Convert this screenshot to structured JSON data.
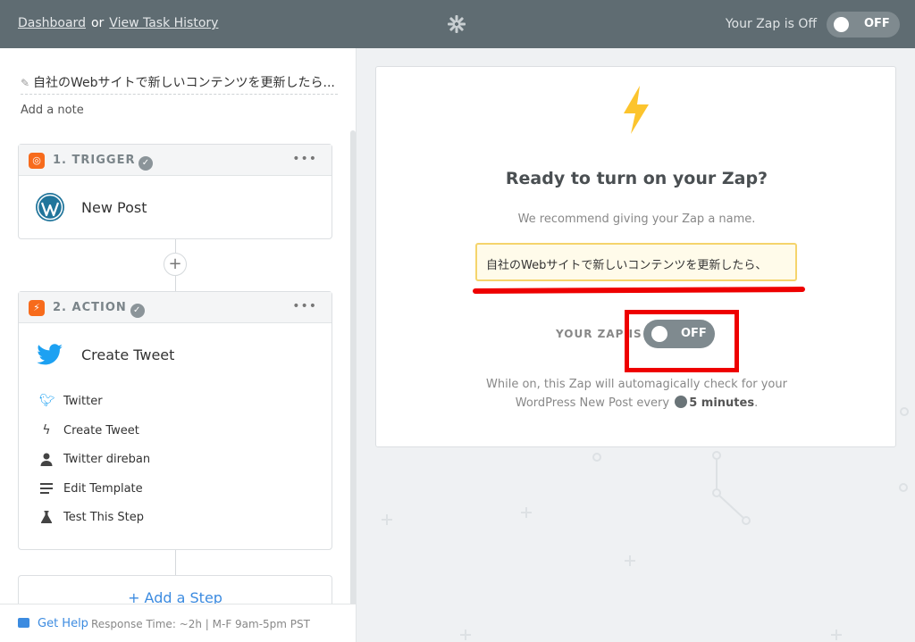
{
  "topbar": {
    "dashboard_link": "Dashboard",
    "or_text": "or",
    "history_link": "View Task History",
    "status_text": "Your Zap is Off",
    "toggle_label": "OFF"
  },
  "editor": {
    "zap_name": "自社のWebサイトで新しいコンテンツを更新したら...",
    "add_note": "Add a note",
    "trigger": {
      "title": "1. TRIGGER",
      "app_name": "New Post",
      "menu": "•••"
    },
    "action": {
      "title": "2. ACTION",
      "app_name": "Create Tweet",
      "menu": "•••",
      "items": [
        {
          "label": "Twitter",
          "icon": "twitter-icon"
        },
        {
          "label": "Create Tweet",
          "icon": "bolt-icon"
        },
        {
          "label": "Twitter direban",
          "icon": "user-icon"
        },
        {
          "label": "Edit Template",
          "icon": "lines-icon"
        },
        {
          "label": "Test This Step",
          "icon": "flask-icon"
        }
      ]
    },
    "add_step": "+ Add a Step"
  },
  "footer": {
    "get_help": "Get Help",
    "response_time": "Response Time: ~2h | M-F 9am-5pm PST"
  },
  "panel": {
    "heading": "Ready to turn on your Zap?",
    "recommend": "We recommend giving your Zap a name.",
    "name_value": "自社のWebサイトで新しいコンテンツを更新したら、",
    "your_zap_label": "YOUR ZAP IS",
    "toggle_label": "OFF",
    "while_on_line1": "While on, this Zap will automagically check for your",
    "while_on_line2_prefix": "WordPress New Post every",
    "interval": "5 minutes",
    "period": "."
  },
  "colors": {
    "accent": "#f76b1c",
    "link": "#3c8be0",
    "topbar": "#5f6c72",
    "highlight": "#ee0000"
  }
}
